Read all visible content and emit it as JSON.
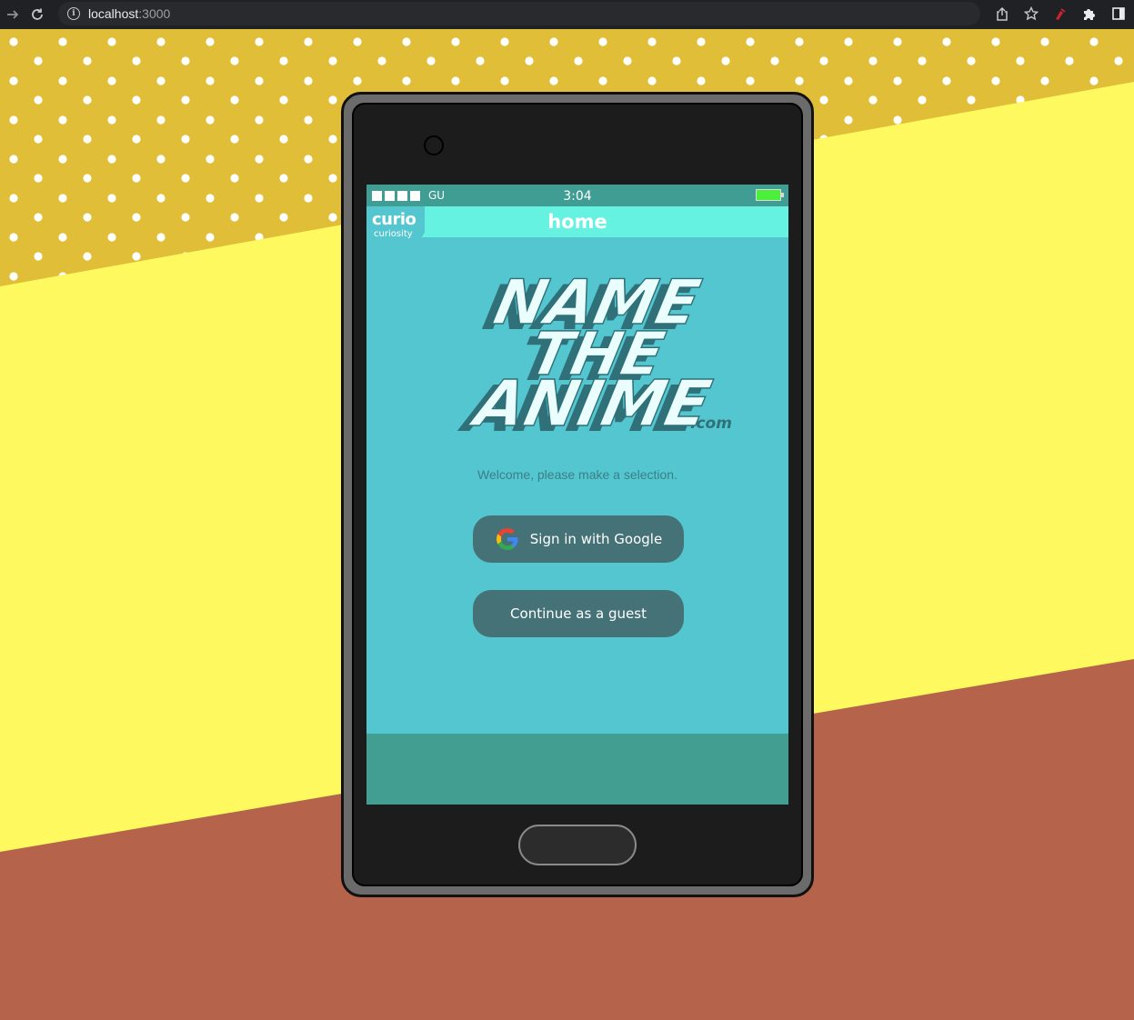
{
  "browser": {
    "url_host": "localhost",
    "url_port": ":3000",
    "back_icon": "arrow-right-icon",
    "reload_icon": "reload-icon",
    "info_icon": "info-icon",
    "share_icon": "share-icon",
    "bookmark_icon": "star-icon",
    "extension_icon": "puzzle-icon",
    "sidepanel_icon": "sidepanel-icon"
  },
  "status_bar": {
    "carrier": "GU",
    "time": "3:04"
  },
  "header": {
    "brand": "curio",
    "brand_sub": "curiosity",
    "title": "home"
  },
  "logo": {
    "line1": "NAME",
    "line2": "THE",
    "line3": "ANIME",
    "suffix": ".com"
  },
  "main": {
    "welcome": "Welcome, please make a selection.",
    "google_button": "Sign in with Google",
    "guest_button": "Continue as a guest"
  },
  "colors": {
    "background_top": "#e0be37",
    "background_mid": "#fdf95e",
    "background_bottom": "#b5634b",
    "screen": "#54c6cf",
    "topbar": "#65f2e0",
    "statusbar": "#3f9d93",
    "button": "#447276",
    "footer": "#429e91"
  }
}
